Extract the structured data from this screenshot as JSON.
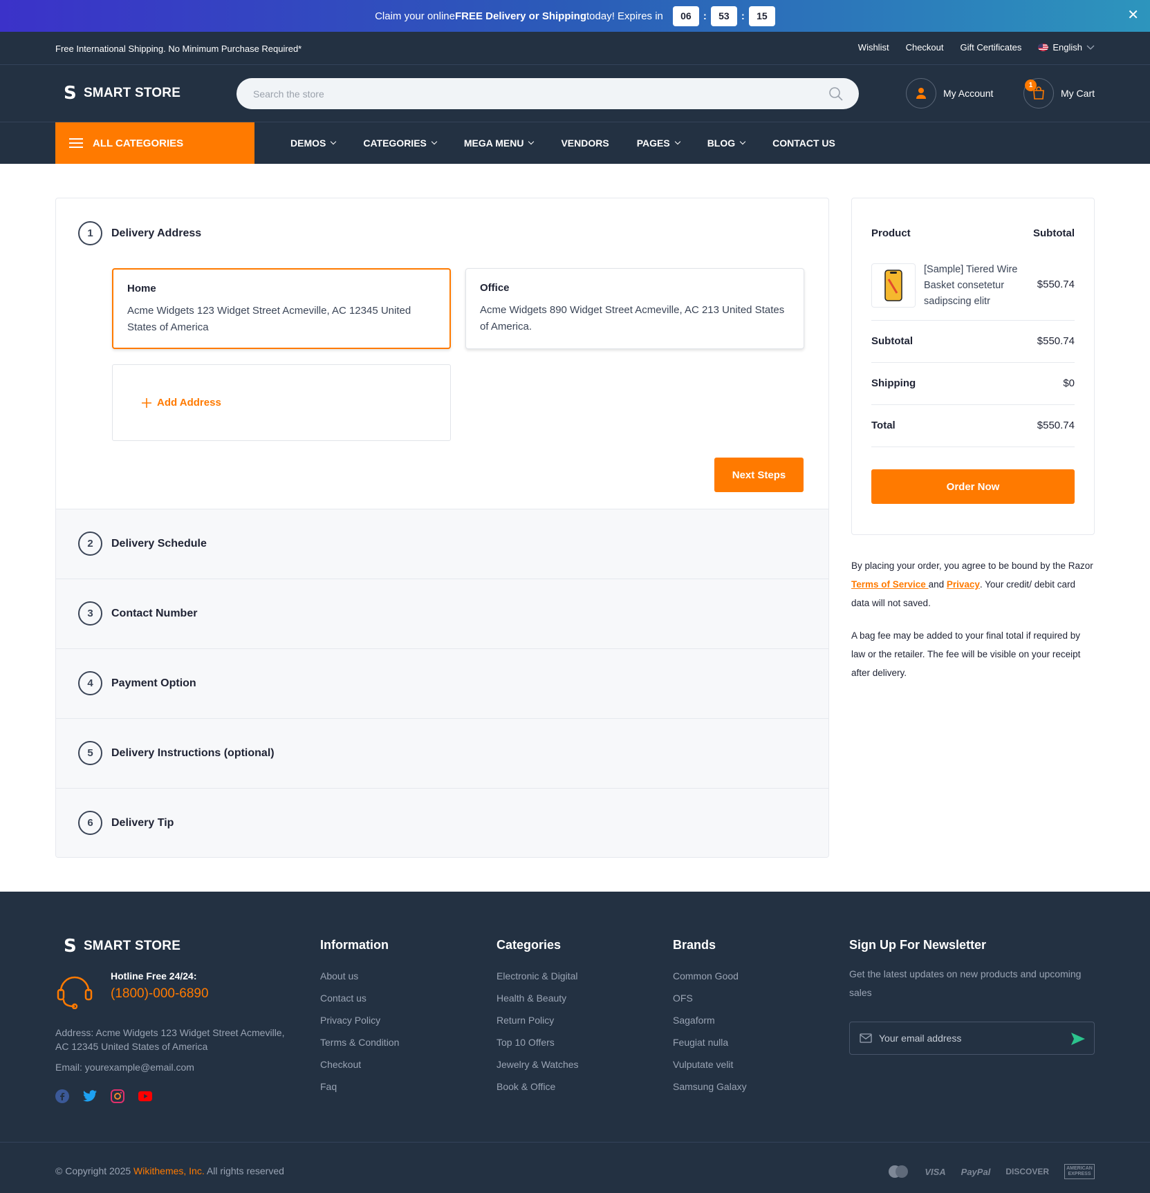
{
  "promo": {
    "prefix": "Claim your online ",
    "bold": "FREE Delivery or Shipping",
    "suffix": " today! Expires in",
    "hours": "06",
    "minutes": "53",
    "seconds": "15",
    "close": "✕"
  },
  "topbar": {
    "note": "Free International Shipping. No Minimum Purchase Required*",
    "links": [
      "Wishlist",
      "Checkout",
      "Gift Certificates"
    ],
    "language": "English"
  },
  "header": {
    "logo_mark": "S",
    "logo_text": "SMART STORE",
    "search_placeholder": "Search the store",
    "account_label": "My Account",
    "cart_label": "My Cart",
    "cart_count": "1"
  },
  "nav": {
    "all_categories": "ALL CATEGORIES",
    "items": [
      "DEMOS",
      "CATEGORIES",
      "MEGA MENU",
      "VENDORS",
      "PAGES",
      "BLOG",
      "CONTACT US"
    ]
  },
  "checkout": {
    "steps": [
      {
        "num": "1",
        "title": "Delivery Address"
      },
      {
        "num": "2",
        "title": "Delivery Schedule"
      },
      {
        "num": "3",
        "title": "Contact Number"
      },
      {
        "num": "4",
        "title": "Payment Option"
      },
      {
        "num": "5",
        "title": "Delivery Instructions (optional)"
      },
      {
        "num": "6",
        "title": "Delivery Tip"
      }
    ],
    "addresses": [
      {
        "title": "Home",
        "text": "Acme Widgets 123 Widget Street Acmeville, AC 12345 United States of America"
      },
      {
        "title": "Office",
        "text": "Acme Widgets 890 Widget Street Acmeville, AC 213 United States of America."
      }
    ],
    "add_address": "Add Address",
    "next_button": "Next Steps"
  },
  "summary": {
    "col_product": "Product",
    "col_subtotal": "Subtotal",
    "item_name": "[Sample] Tiered Wire Basket consetetur sadipscing elitr",
    "item_price": "$550.74",
    "subtotal_label": "Subtotal",
    "subtotal_value": "$550.74",
    "shipping_label": "Shipping",
    "shipping_value": "$0",
    "total_label": "Total",
    "total_value": "$550.74",
    "order_button": "Order Now"
  },
  "legal": {
    "p1_a": "By placing your order, you agree to be bound by the Razor ",
    "tos": "Terms of Service ",
    "and": "and ",
    "privacy": "Privacy",
    "p1_b": ". Your credit/ debit card data will not saved.",
    "p2": "A bag fee may be added to your final total if required by law or the retailer. The fee will be visible on your receipt after delivery."
  },
  "footer": {
    "logo_mark": "S",
    "logo_text": "SMART STORE",
    "hotline_label": "Hotline Free 24/24:",
    "hotline_number": "(1800)-000-6890",
    "address": "Address: Acme Widgets 123 Widget Street Acmeville, AC 12345 United States of America",
    "email": "Email: yourexample@email.com",
    "information_title": "Information",
    "information": [
      "About us",
      "Contact us",
      "Privacy Policy",
      "Terms & Condition",
      "Checkout",
      "Faq"
    ],
    "categories_title": "Categories",
    "categories": [
      "Electronic & Digital",
      "Health & Beauty",
      "Return Policy",
      "Top 10 Offers",
      "Jewelry & Watches",
      "Book & Office"
    ],
    "brands_title": "Brands",
    "brands": [
      "Common Good",
      "OFS",
      "Sagaform",
      "Feugiat nulla",
      "Vulputate velit",
      "Samsung Galaxy"
    ],
    "newsletter_title": "Sign Up For Newsletter",
    "newsletter_text": "Get the latest updates on new products and upcoming sales",
    "email_placeholder": "Your email address",
    "copyright_prefix": "© Copyright 2025 ",
    "copyright_company": "Wikithemes, Inc.",
    "copyright_suffix": "  All rights reserved",
    "payments": [
      "VISA",
      "PayPal",
      "DISCOVER",
      "AMERICAN EXPRESS"
    ]
  },
  "colors": {
    "accent": "#ff7a00",
    "dark": "#233142"
  }
}
